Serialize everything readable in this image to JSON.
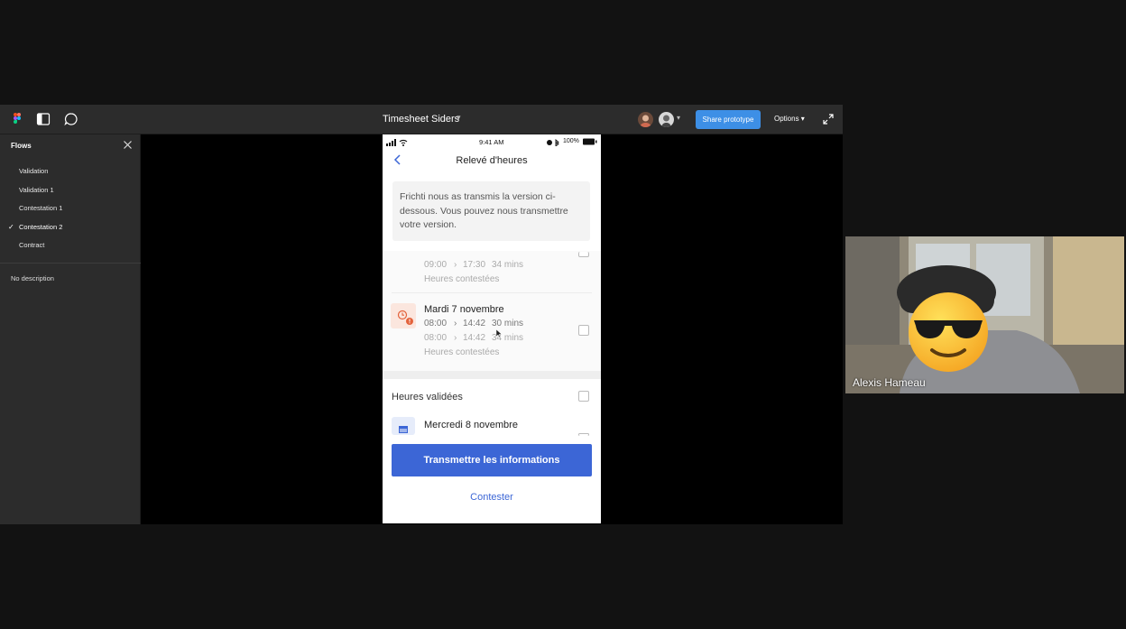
{
  "figma": {
    "document_title": "Timesheet Siders",
    "share_button_label": "Share prototype",
    "options_label": "Options",
    "flows": {
      "title": "Flows",
      "items": [
        "Validation",
        "Validation 1",
        "Contestation 1",
        "Contestation 2",
        "Contract"
      ],
      "selected": "Contestation 2",
      "description": "No description"
    }
  },
  "phone": {
    "status_time": "9:41 AM",
    "battery": "100%",
    "title": "Relevé d'heures",
    "info_text": "Frichti nous as transmis la version ci-dessous. Vous pouvez nous transmettre votre version.",
    "entry_top": {
      "start": "09:00",
      "end": "17:30",
      "pause": "34 mins",
      "status": "Heures contestées"
    },
    "entry_mardi": {
      "day": "Mardi 7 novembre",
      "start": "08:00",
      "end": "14:42",
      "pause": "30 mins",
      "orig_start": "08:00",
      "orig_end": "14:42",
      "orig_pause": "34 mins",
      "status": "Heures contestées"
    },
    "validated_section": "Heures validées",
    "entry_mercredi_day": "Mercredi 8 novembre",
    "primary_button": "Transmettre les informations",
    "secondary_link": "Contester",
    "accent_color": "#3c66d6",
    "warning_color": "#e3623b"
  },
  "video": {
    "participant_name": "Alexis Hameau",
    "overlay_icon": "sunglasses-emoji"
  }
}
